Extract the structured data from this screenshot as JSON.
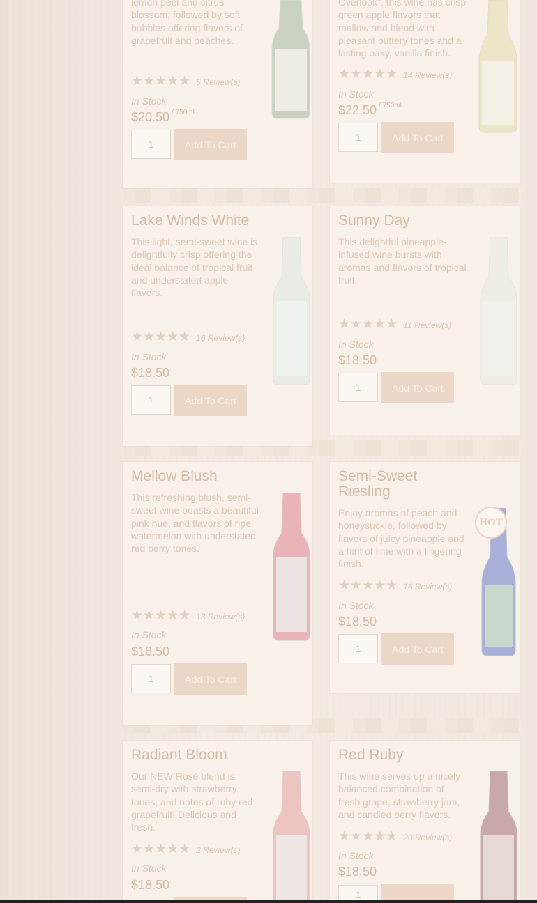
{
  "colors": {
    "background": "#f2ebe2",
    "card": "#f7f1ea",
    "title": "#d5bca4",
    "button": "#ead7c7",
    "button_text": "#f8efe6"
  },
  "common": {
    "add_to_cart_label": "Add To Cart",
    "default_qty": "1",
    "in_stock": "In Stock"
  },
  "products": [
    {
      "title": "",
      "description": "lemon peel and citrus blossom; followed by soft bubbles offering flavors of grapefruit and peaches.",
      "stars_glyph": "★★★★★",
      "rating": 5,
      "reviews": "5 Review(s)",
      "stock": "In Stock",
      "price": "$20.50",
      "unit": "/ 750ml",
      "bottle_color": "#c9d2c0",
      "hot": false
    },
    {
      "title": "",
      "description": "Overlook\", this wine has crisp green apple flavors that mellow and blend with pleasant buttery tones and a lasting oaky, vanilla finish.",
      "stars_glyph": "★★★★★",
      "rating": 5,
      "reviews": "14 Review(s)",
      "stock": "In Stock",
      "price": "$22.50",
      "unit": "/ 750ml",
      "bottle_color": "#ece6c8",
      "hot": false
    },
    {
      "title": "Lake Winds White",
      "description": "This light, semi-sweet wine is delightfully crisp offering the ideal balance of tropical fruit and understated apple flavors.",
      "stars_glyph": "★★★★★",
      "rating": 5,
      "reviews": "16 Review(s)",
      "stock": "In Stock",
      "price": "$18.50",
      "unit": "",
      "bottle_color": "#e8ece4",
      "hot": false
    },
    {
      "title": "Sunny Day",
      "description": "This delightful pineapple-infused wine bursts with aromas and flavors of tropical fruit.",
      "stars_glyph": "★★★★★",
      "rating": 5,
      "reviews": "11 Review(s)",
      "stock": "In Stock",
      "price": "$18.50",
      "unit": "",
      "bottle_color": "#eeeee6",
      "hot": false
    },
    {
      "title": "Mellow Blush",
      "description": "This refreshing blush, semi-sweet wine boasts a beautiful pink hue, and flavors of ripe watermelon with understated red berry tones.",
      "stars_glyph": "★★★★★",
      "rating": 5,
      "reviews": "13 Review(s)",
      "stock": "In Stock",
      "price": "$18.50",
      "unit": "",
      "bottle_color": "#e8b4b8",
      "hot": false
    },
    {
      "title": "Semi-Sweet Riesling",
      "description": "Enjoy aromas of peach and honeysuckle, followed by flavors of juicy pineapple and a hint of lime with a lingering finish.",
      "stars_glyph": "★★★★★",
      "rating": 5,
      "reviews": "16 Review(s)",
      "stock": "In Stock",
      "price": "$18.50",
      "unit": "",
      "bottle_color": "#a8b0d8",
      "hot": true,
      "hot_label": "HOT"
    },
    {
      "title": "Radiant Bloom",
      "description": "Our NEW Rosé blend is semi-dry with strawberry tones, and notes of ruby red grapefruit! Delicious and fresh.",
      "stars_glyph": "★★★★★",
      "rating": 5,
      "reviews": "2 Review(s)",
      "stock": "In Stock",
      "price": "$18.50",
      "unit": "",
      "bottle_color": "#ecc4c0",
      "hot": false
    },
    {
      "title": "Red Ruby",
      "description": "This wine serves up a nicely balanced combination of fresh grape, strawberry jam, and candied berry flavors.",
      "stars_glyph": "★★★★★",
      "rating": 5,
      "reviews": "20 Review(s)",
      "stock": "In Stock",
      "price": "$18.50",
      "unit": "",
      "bottle_color": "#c8a8a8",
      "hot": false
    }
  ]
}
